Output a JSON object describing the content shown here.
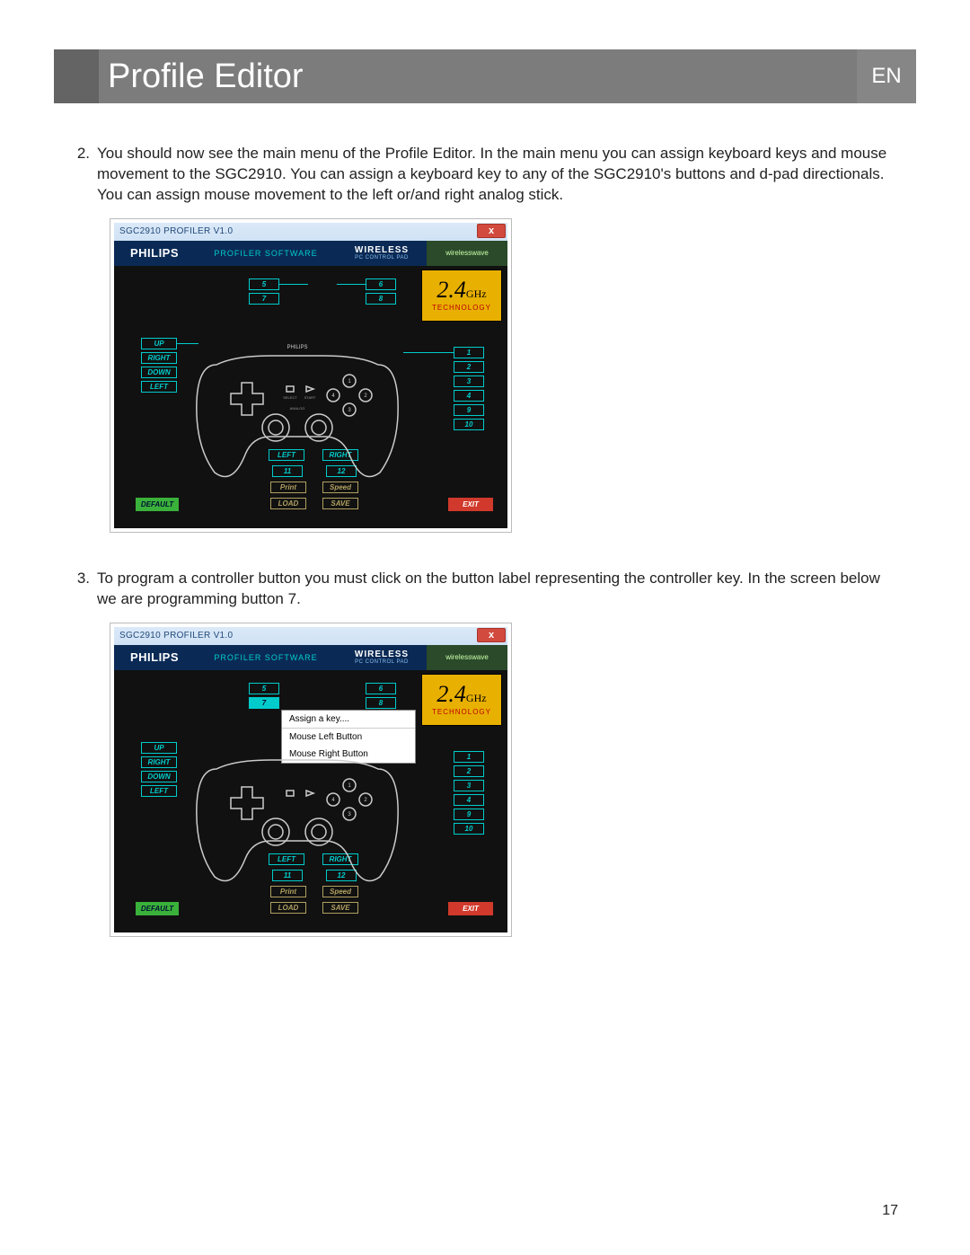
{
  "header": {
    "title": "Profile Editor",
    "lang": "EN"
  },
  "steps": [
    {
      "num": "2.",
      "text": "You should now see the main menu of the Profile Editor. In the main menu you can assign keyboard keys and mouse movement to the SGC2910. You can assign a keyboard key to any of the SGC2910's buttons and d-pad directionals. You can assign mouse movement to the left or/and right analog stick."
    },
    {
      "num": "3.",
      "text": "To program a controller button you must click on the button label representing the controller key. In the screen below we are programming button 7."
    }
  ],
  "app": {
    "window_title": "SGC2910 PROFILER V1.0",
    "close": "x",
    "philips": "PHILIPS",
    "profiler_software": "PROFILER SOFTWARE",
    "wireless": "WIRELESS",
    "wireless_sub": "PC CONTROL PAD",
    "brand2": "wirelesswave",
    "badge_num": "2.4",
    "badge_ghz": "GHz",
    "badge_tech": "TECHNOLOGY",
    "pad_brand": "PHILIPS",
    "pad_select": "SELECT",
    "pad_analog": "ANALOG",
    "pad_start": "START",
    "dpad": {
      "up": "UP",
      "right": "RIGHT",
      "down": "DOWN",
      "left": "LEFT"
    },
    "top_buttons": {
      "b5": "5",
      "b7": "7",
      "b6": "6",
      "b8": "8"
    },
    "right_buttons": {
      "b1": "1",
      "b2": "2",
      "b3": "3",
      "b4": "4",
      "b9": "9",
      "b10": "10"
    },
    "sticks": {
      "left": "LEFT",
      "right": "RIGHT",
      "b11": "11",
      "b12": "12"
    },
    "actions": {
      "print": "Print",
      "speed": "Speed",
      "load": "LOAD",
      "save": "SAVE",
      "default": "DEFAULT",
      "exit": "EXIT"
    }
  },
  "context_menu": {
    "assign": "Assign a key....",
    "mlb": "Mouse Left Button",
    "mrb": "Mouse Right Button"
  },
  "page_number": "17"
}
